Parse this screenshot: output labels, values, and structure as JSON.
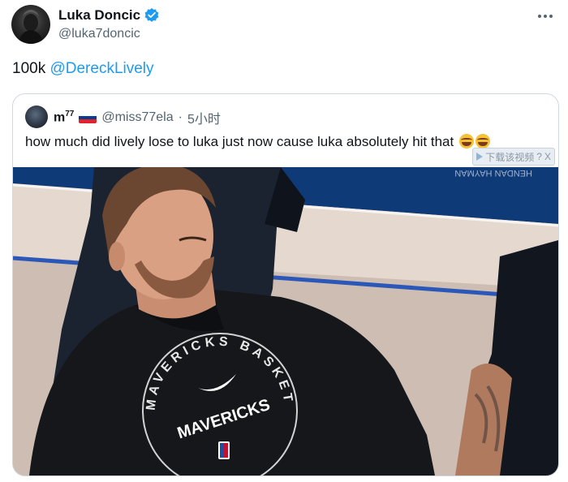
{
  "author": {
    "display_name": "Luka Doncic",
    "handle": "@luka7doncic"
  },
  "tweet": {
    "text_prefix": "100k ",
    "mention": "@DereckLively"
  },
  "quoted": {
    "name": "m",
    "name_sup": "77",
    "handle": "@miss77ela",
    "separator": "·",
    "time": "5小时",
    "text": "how much did lively lose to luka just now cause luka absolutely hit that"
  },
  "media_overlay": {
    "download_label": "下载该视频",
    "question": "?",
    "close": "X"
  },
  "shirt": {
    "top_text": "MAVERICKS BASKETBALL",
    "center_text": "MAVERICKS"
  },
  "banner_text": "HENDAN HAYMAN",
  "colors": {
    "accent": "#1d9bf0",
    "text": "#0f1419",
    "muted": "#536471",
    "border": "#cfd9de"
  },
  "icons": [
    "verified-badge-icon",
    "more-options-icon",
    "slovenia-flag-icon",
    "laughing-emoji-icon",
    "play-icon"
  ]
}
